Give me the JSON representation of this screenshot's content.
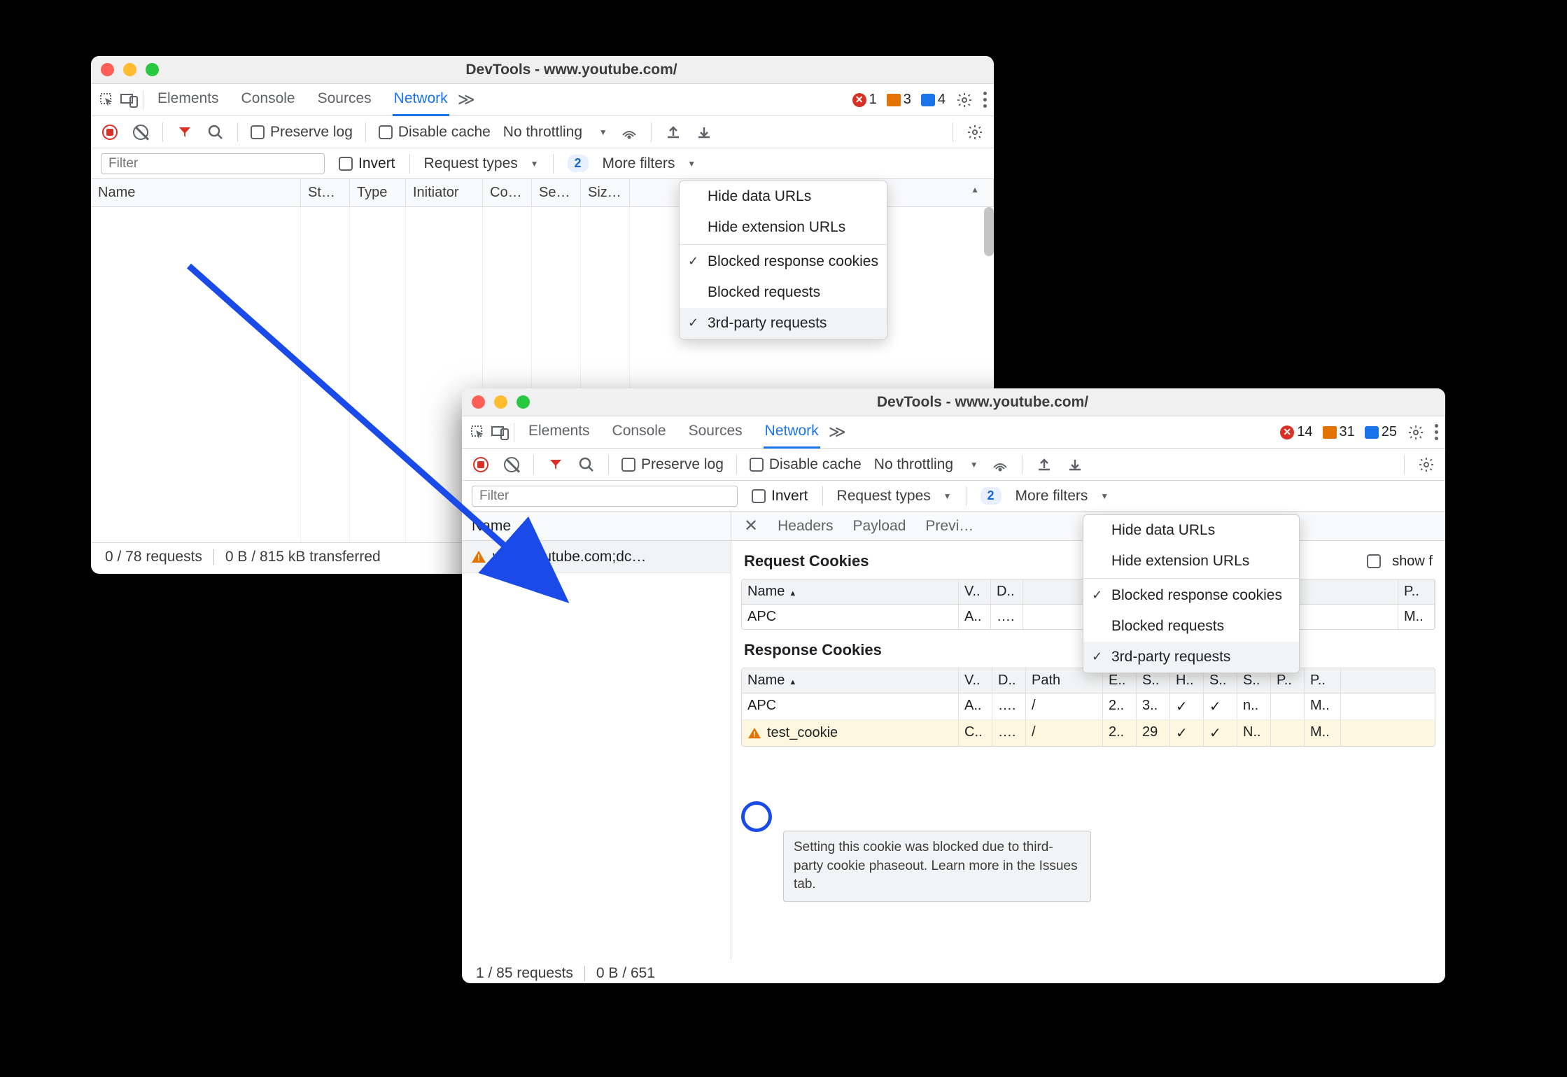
{
  "win1": {
    "title": "DevTools - www.youtube.com/",
    "tabs": [
      "Elements",
      "Console",
      "Sources",
      "Network"
    ],
    "active_tab": "Network",
    "counters": {
      "errors": 1,
      "warnings": 3,
      "info": 4
    },
    "toolbar": {
      "preserve": "Preserve log",
      "disable_cache": "Disable cache",
      "throttling": "No throttling"
    },
    "filter": {
      "placeholder": "Filter",
      "invert": "Invert",
      "request_types": "Request types",
      "more_filters": "More filters",
      "badge": "2"
    },
    "columns": [
      "Name",
      "St…",
      "Type",
      "Initiator",
      "Co…",
      "Se…",
      "Siz…"
    ],
    "status": {
      "requests": "0 / 78 requests",
      "transferred": "0 B / 815 kB transferred"
    },
    "menu": {
      "items": [
        "Hide data URLs",
        "Hide extension URLs",
        "Blocked response cookies",
        "Blocked requests",
        "3rd-party requests"
      ],
      "checked": [
        2,
        4
      ]
    }
  },
  "win2": {
    "title": "DevTools - www.youtube.com/",
    "tabs": [
      "Elements",
      "Console",
      "Sources",
      "Network"
    ],
    "active_tab": "Network",
    "counters": {
      "errors": 14,
      "warnings": 31,
      "info": 25
    },
    "toolbar": {
      "preserve": "Preserve log",
      "disable_cache": "Disable cache",
      "throttling": "No throttling"
    },
    "filter": {
      "placeholder": "Filter",
      "invert": "Invert",
      "request_types": "Request types",
      "more_filters": "More filters",
      "badge": "2"
    },
    "sidebar": {
      "header": "Name",
      "row": "www.youtube.com;dc…"
    },
    "detail_tabs": [
      "Headers",
      "Payload",
      "Previ…"
    ],
    "request_cookies": {
      "title": "Request Cookies",
      "show_filtered": "show f",
      "cols": [
        "Name",
        "V..",
        "D..",
        "P.."
      ],
      "row": [
        "APC",
        "A..",
        "….",
        "M.."
      ]
    },
    "response_cookies": {
      "title": "Response Cookies",
      "cols": [
        "Name",
        "V..",
        "D..",
        "Path",
        "E..",
        "S..",
        "H..",
        "S..",
        "S..",
        "P..",
        "P.."
      ],
      "rows": [
        [
          "APC",
          "A..",
          "….",
          "/",
          "2..",
          "3..",
          "✓",
          "✓",
          "n..",
          "",
          "M.."
        ],
        [
          "test_cookie",
          "C..",
          "….",
          "/",
          "2..",
          "29",
          "✓",
          "✓",
          "N..",
          "",
          "M.."
        ]
      ]
    },
    "tooltip": "Setting this cookie was blocked due to third-party cookie phaseout. Learn more in the Issues tab.",
    "status": {
      "requests": "1 / 85 requests",
      "transferred": "0 B / 651"
    },
    "menu": {
      "items": [
        "Hide data URLs",
        "Hide extension URLs",
        "Blocked response cookies",
        "Blocked requests",
        "3rd-party requests"
      ],
      "checked": [
        2,
        4
      ]
    }
  }
}
